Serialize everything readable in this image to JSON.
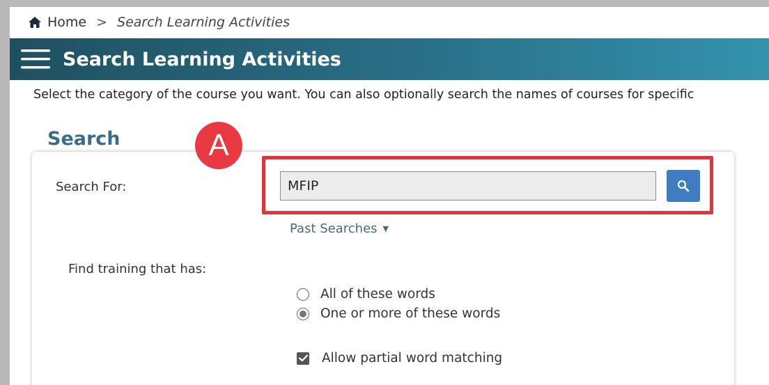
{
  "breadcrumb": {
    "home": "Home",
    "separator": ">",
    "current": "Search Learning Activities"
  },
  "header": {
    "title": "Search Learning Activities"
  },
  "intro_text": "Select the category of the course you want. You can also optionally search the names of courses for specific",
  "tab": {
    "label": "Search"
  },
  "annotation": {
    "badge": "A",
    "color": "#e2333b"
  },
  "search": {
    "label": "Search For:",
    "value": "MFIP",
    "past_searches": "Past Searches"
  },
  "find": {
    "label": "Find training that has:",
    "options": [
      {
        "label": "All of these words",
        "checked": false
      },
      {
        "label": "One or more of these words",
        "checked": true
      }
    ],
    "partial_label": "Allow partial word matching",
    "partial_checked": true
  },
  "colors": {
    "accent": "#3a6c8c",
    "button": "#3f7cc1",
    "header_start": "#1f5060",
    "header_end": "#3392ad"
  },
  "icons": {
    "home": "home-icon",
    "menu": "hamburger-menu-icon",
    "search": "search-icon",
    "dropdown": "triangle-down-icon"
  }
}
